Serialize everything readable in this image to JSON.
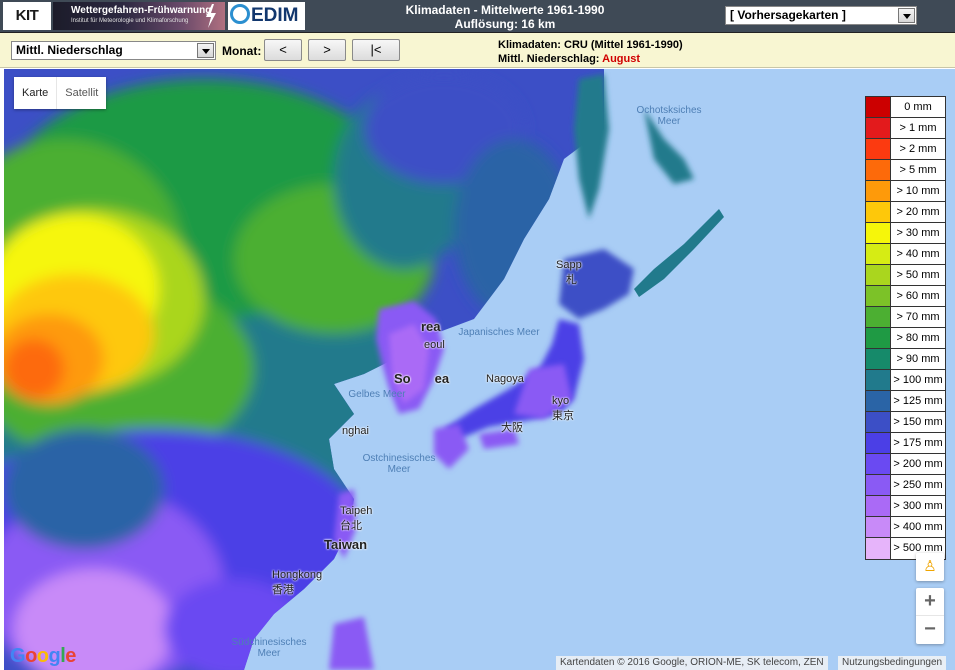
{
  "header": {
    "kit_logo": "KIT",
    "banner_title": "Wettergefahren-Frühwarnung",
    "banner_subtitle": "Institut für Meteorologie und Klimaforschung",
    "cedim_logo": "EDIM",
    "title_line1": "Klimadaten - Mittelwerte 1961-1990",
    "title_line2": "Auflösung: 16 km",
    "forecast_select": "[ Vorhersagekarten ]"
  },
  "toolbar": {
    "variable_select": "Mittl. Niederschlag",
    "month_label": "Monat:",
    "prev_label": "<",
    "next_label": ">",
    "reset_label": "|<",
    "info_line1": "Klimadaten: CRU (Mittel 1961-1990)",
    "info_line2_prefix": "Mittl. Niederschlag:",
    "info_month": "August"
  },
  "map": {
    "map_type_buttons": [
      "Karte",
      "Satellit"
    ],
    "sea_labels": {
      "okhotsk_1": "Ochotsksiches",
      "okhotsk_2": "Meer",
      "japan_sea": "Japanisches Meer",
      "yellow_sea": "Gelbes Meer",
      "east_china_1": "Ostchinesisches",
      "east_china_2": "Meer",
      "south_china_1": "Südchinesisches",
      "south_china_2": "Meer"
    },
    "cities": {
      "sapporo": "Sapp",
      "sapporo_kanji": "札",
      "korea": "rea",
      "seoul": "eoul",
      "south_korea": "So",
      "south_korea_end": "ea",
      "nagoya": "Nagoya",
      "tokyo": "kyo",
      "tokyo_kanji": "東京",
      "osaka_kanji": "大阪",
      "shanghai": "nghai",
      "taipei": "Taipeh",
      "taipei_kanji": "台北",
      "taiwan": "Taiwan",
      "hongkong": "Hongkong",
      "hongkong_kanji": "香港"
    },
    "google": [
      "G",
      "o",
      "o",
      "g",
      "l",
      "e"
    ],
    "attribution": "Kartendaten © 2016 Google, ORION-ME, SK telecom, ZEN",
    "terms": "Nutzungsbedingungen",
    "zoom_in": "+",
    "zoom_out": "−",
    "pegman_icon": "pegman-icon"
  },
  "legend": [
    {
      "label": "0 mm",
      "color": "#cc0000"
    },
    {
      "label": "> 1 mm",
      "color": "#e31a1c"
    },
    {
      "label": "> 2 mm",
      "color": "#fc3a10"
    },
    {
      "label": "> 5 mm",
      "color": "#fd6a0a"
    },
    {
      "label": "> 10 mm",
      "color": "#fe9a0a"
    },
    {
      "label": "> 20 mm",
      "color": "#fec80a"
    },
    {
      "label": "> 30 mm",
      "color": "#f6f60a"
    },
    {
      "label": "> 40 mm",
      "color": "#d6ec14"
    },
    {
      "label": "> 50 mm",
      "color": "#aad61e"
    },
    {
      "label": "> 60 mm",
      "color": "#7cc228"
    },
    {
      "label": "> 70 mm",
      "color": "#4caf32"
    },
    {
      "label": "> 80 mm",
      "color": "#1f9a44"
    },
    {
      "label": "> 90 mm",
      "color": "#168a6a"
    },
    {
      "label": "> 100 mm",
      "color": "#217a8c"
    },
    {
      "label": "> 125 mm",
      "color": "#2a64a6"
    },
    {
      "label": "> 150 mm",
      "color": "#3c4fc6"
    },
    {
      "label": "> 175 mm",
      "color": "#4b3fe6"
    },
    {
      "label": "> 200 mm",
      "color": "#6a4af2"
    },
    {
      "label": "> 250 mm",
      "color": "#8a5af4"
    },
    {
      "label": "> 300 mm",
      "color": "#aa6af6"
    },
    {
      "label": "> 400 mm",
      "color": "#c88af8"
    },
    {
      "label": "> 500 mm",
      "color": "#e6b4fa"
    }
  ]
}
